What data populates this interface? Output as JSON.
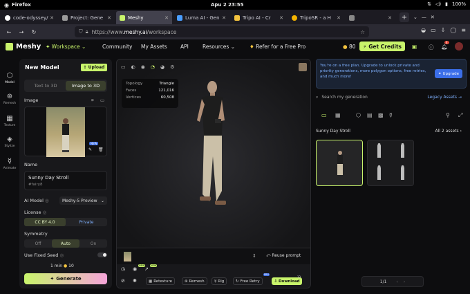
{
  "os": {
    "app_name": "Firefox",
    "clock": "Apu 2  23:55",
    "battery": "100%"
  },
  "browser": {
    "tabs": [
      {
        "title": "code-odyssey/",
        "color": "#ffffff",
        "active": false
      },
      {
        "title": "Project: Gene",
        "color": "#9b9b9b",
        "active": false
      },
      {
        "title": "Meshy",
        "color": "#c8f46b",
        "active": true
      },
      {
        "title": "Luma AI - Gen",
        "color": "#4a9eff",
        "active": false
      },
      {
        "title": "Tripo AI - Cr",
        "color": "#f3c33f",
        "active": false
      },
      {
        "title": "TripoSR - a H",
        "color": "#f5b400",
        "active": false
      },
      {
        "title": "",
        "color": "#888888",
        "active": false
      }
    ],
    "url_prefix": "https://www.",
    "url_domain": "meshy.ai",
    "url_path": "/workspace"
  },
  "topnav": {
    "logo": "Meshy",
    "workspace": "Workspace",
    "community": "Community",
    "my_assets": "My Assets",
    "api": "API",
    "resources": "Resources",
    "refer": "Refer for a Free Pro",
    "credits_count": "80",
    "get_credits": "Get Credits",
    "notif_count": "4"
  },
  "rail": {
    "model": "Model",
    "remesh": "Remesh",
    "texture": "Texture",
    "stylize": "Stylize",
    "animate": "Animate"
  },
  "left": {
    "title": "New Model",
    "upload": "Upload",
    "mode_text": "Text to 3D",
    "mode_image": "Image to 3D",
    "image_label": "Image",
    "new_badge": "NEW",
    "name_label": "Name",
    "name_value": "Sunny Day Stroll",
    "name_tag": "#fairy8",
    "ai_model_label": "AI Model",
    "ai_model_value": "Meshy-5 Preview",
    "license_label": "License",
    "license_cc": "CC BY 4.0",
    "license_private": "Private",
    "symmetry_label": "Symmetry",
    "sym_off": "Off",
    "sym_auto": "Auto",
    "sym_on": "On",
    "fixed_seed_label": "Use Fixed Seed",
    "time": "1 min",
    "cost": "10",
    "generate": "Generate"
  },
  "viewer": {
    "stats": [
      {
        "k": "Topology",
        "v": "Triangle"
      },
      {
        "k": "Faces",
        "v": "121,016"
      },
      {
        "k": "Vertices",
        "v": "60,508"
      }
    ],
    "reuse_prompt": "Reuse prompt",
    "badge1": "NEW",
    "badge2": "NEW",
    "retexture": "Retexture",
    "remesh": "Remesh",
    "rig": "Rig",
    "free_retry": "Free Retry",
    "download": "Download",
    "pro_badge": "PRO",
    "dl_count": "13"
  },
  "right": {
    "banner": "You're on a free plan. Upgrade to unlock private and priority generations, more polygon options, free retries, and much more!",
    "upgrade": "Upgrade",
    "search_placeholder": "Search my generation",
    "legacy": "Legacy Assets",
    "group_title": "Sunny Day Stroll",
    "assets_count": "All 2 assets",
    "page": "1/1"
  }
}
